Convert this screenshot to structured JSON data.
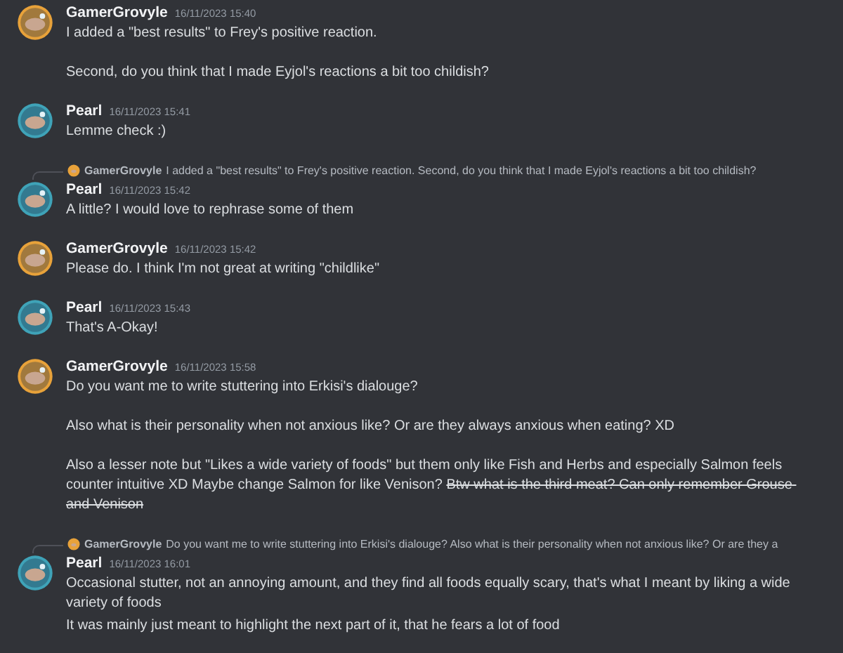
{
  "messages": [
    {
      "author": "GamerGrovyle",
      "color": "#e8a23a",
      "time": "16/11/2023 15:40",
      "lines": [
        {
          "text": "I added a \"best results\" to Frey's positive reaction.\n\nSecond, do you think that I made Eyjol's reactions a bit too childish?"
        }
      ]
    },
    {
      "author": "Pearl",
      "color": "#3fa3b8",
      "time": "16/11/2023 15:41",
      "lines": [
        {
          "text": "Lemme check :)"
        }
      ]
    },
    {
      "author": "Pearl",
      "color": "#3fa3b8",
      "time": "16/11/2023 15:42",
      "reply": {
        "author": "GamerGrovyle",
        "color": "#e8a23a",
        "text": "I added a \"best results\" to Frey's positive reaction. Second, do you think that I made Eyjol's reactions a bit too childish?"
      },
      "lines": [
        {
          "text": "A little? I would love to rephrase some of them"
        }
      ]
    },
    {
      "author": "GamerGrovyle",
      "color": "#e8a23a",
      "time": "16/11/2023 15:42",
      "lines": [
        {
          "text": "Please do. I think I'm not great at writing \"childlike\""
        }
      ]
    },
    {
      "author": "Pearl",
      "color": "#3fa3b8",
      "time": "16/11/2023 15:43",
      "lines": [
        {
          "text": "That's A-Okay!"
        }
      ]
    },
    {
      "author": "GamerGrovyle",
      "color": "#e8a23a",
      "time": "16/11/2023 15:58",
      "lines": [
        {
          "text": "Do you want me to write stuttering into Erkisi's dialouge?\n\nAlso what is their personality when not anxious like? Or are they always anxious when eating? XD\n\nAlso a lesser note but \"Likes a wide variety of foods\" but them only like Fish and Herbs and especially Salmon feels counter intuitive XD Maybe change Salmon for like Venison?",
          "struck": "Btw what is the third meat? Can only remember Grouse and Venison"
        }
      ]
    },
    {
      "author": "Pearl",
      "color": "#3fa3b8",
      "time": "16/11/2023 16:01",
      "reply": {
        "author": "GamerGrovyle",
        "color": "#e8a23a",
        "text": "Do you want me to write stuttering into Erkisi's dialouge? Also what is their personality when not anxious like? Or are they a"
      },
      "lines": [
        {
          "text": "Occasional stutter, not an annoying amount, and they find all foods equally scary, that's what I meant by liking a wide variety of foods"
        },
        {
          "text": "It was mainly just meant to highlight the next part of it, that he fears a lot of food"
        }
      ]
    }
  ]
}
